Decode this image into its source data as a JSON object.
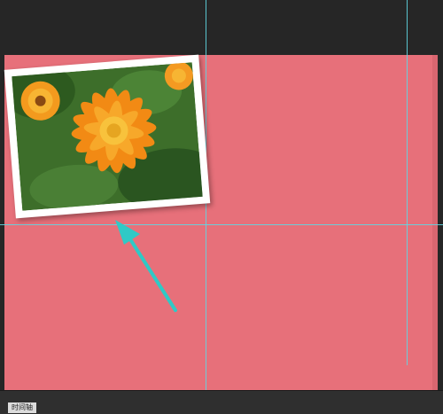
{
  "status_tab": {
    "label": "时间轴"
  },
  "colors": {
    "canvas": "#e7707a",
    "guide": "#5fd6e2",
    "arrow": "#2fc9c6",
    "chrome": "#262626"
  },
  "icons": {
    "arrow": "annotation-arrow-icon"
  }
}
